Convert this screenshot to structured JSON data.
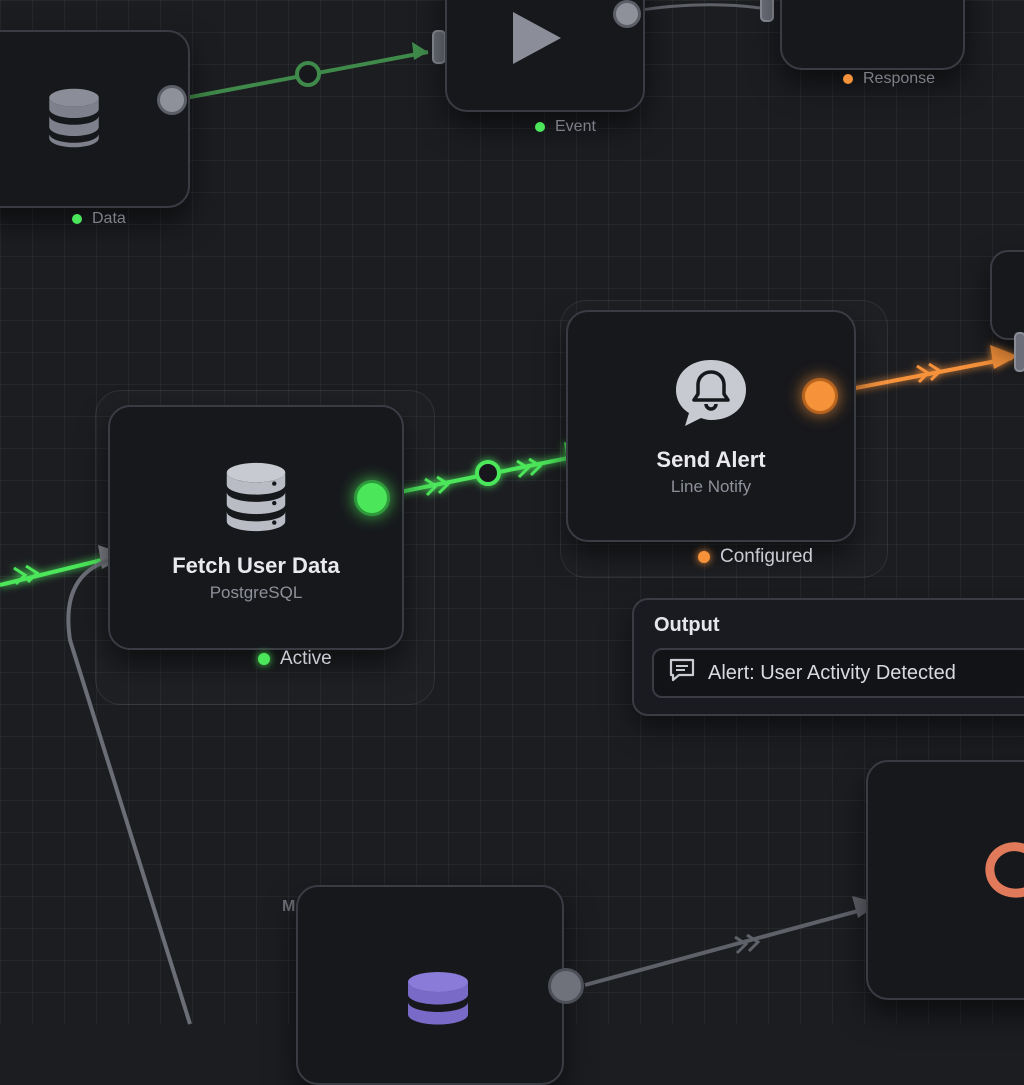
{
  "canvas": {
    "background": "#1c1d21",
    "grid": true
  },
  "colors": {
    "active": "#4ce65a",
    "configured": "#f5923a",
    "neutral_wire": "#6b6e76",
    "message_db": "#8b7bd8"
  },
  "nodes": {
    "fetch_user_data": {
      "title": "Fetch User Data",
      "subtitle": "PostgreSQL",
      "status": "Active",
      "status_color": "#4ce65a",
      "icon": "database-icon"
    },
    "send_alert": {
      "title": "Send Alert",
      "subtitle": "Line Notify",
      "status": "Configured",
      "status_color": "#f5923a",
      "icon": "bell-chat-icon"
    },
    "data": {
      "status": "Data",
      "status_color": "#4ce65a",
      "icon": "database-icon"
    },
    "event": {
      "status": "Event",
      "status_color": "#4ce65a",
      "icon": "play-icon"
    },
    "response": {
      "status": "Response",
      "status_color": "#f5923a"
    },
    "message": {
      "label": "Message",
      "icon": "database-icon"
    },
    "loop": {
      "icon": "loop-icon"
    }
  },
  "output": {
    "label": "Output",
    "value": "Alert: User Activity Detected",
    "icon": "message-icon"
  }
}
